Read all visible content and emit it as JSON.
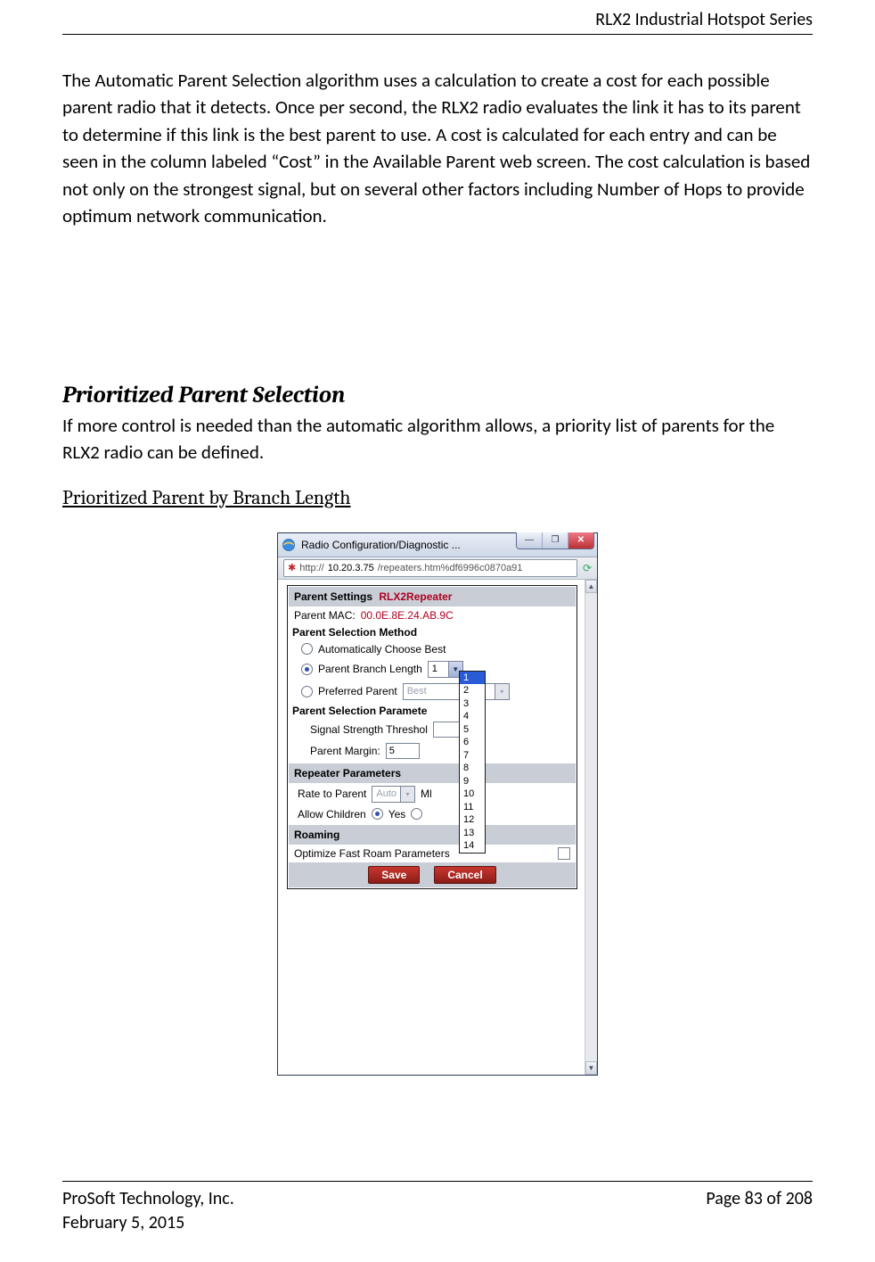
{
  "header": {
    "series": "RLX2 Industrial Hotspot Series"
  },
  "para1": "The Automatic Parent Selection algorithm uses a calculation to create a cost for each possible parent radio that it detects.  Once per second, the RLX2 radio evaluates the link it has to its parent to determine if this link is the best parent to use.  A cost is calculated for each entry and can be seen in the column labeled “Cost” in the Available Parent web screen.  The cost calculation is based not only on the strongest signal, but on several other factors including Number of Hops to provide optimum network communication.",
  "heading2": "Prioritized Parent Selection",
  "para2": "If more control is needed than the automatic algorithm allows, a priority list of parents for the RLX2 radio can be defined.",
  "heading3": "Prioritized Parent by Branch Length",
  "dialog": {
    "title": "Radio Configuration/Diagnostic ...",
    "url_prefix": "http://",
    "url_host": "10.20.3.75",
    "url_path": "/repeaters.htm%df6996c0870a91",
    "parent_settings_label": "Parent Settings",
    "parent_settings_name": "RLX2Repeater",
    "parent_mac_label": "Parent MAC:",
    "parent_mac_value": "00.0E.8E.24.AB.9C",
    "psm_label": "Parent Selection Method",
    "opt_auto": "Automatically Choose Best",
    "opt_branch": "Parent Branch Length",
    "branch_value": "1",
    "opt_preferred": "Preferred Parent",
    "preferred_value": "Best",
    "psp_label": "Parent Selection Paramete",
    "sst_label": "Signal Strength Threshol",
    "pm_label": "Parent Margin:",
    "pm_value": "5",
    "rp_label": "Repeater Parameters",
    "rate_label": "Rate to Parent",
    "rate_value": "Auto",
    "rate_unit": "Ml",
    "allow_label": "Allow Children",
    "yes_label": "Yes",
    "roaming_label": "Roaming",
    "ofrp_label": "Optimize Fast Roam Parameters",
    "save": "Save",
    "cancel": "Cancel",
    "dd_options": [
      "1",
      "2",
      "3",
      "4",
      "5",
      "6",
      "7",
      "8",
      "9",
      "10",
      "11",
      "12",
      "13",
      "14"
    ]
  },
  "footer": {
    "company": "ProSoft Technology, Inc.",
    "date": "February 5, 2015",
    "page": "Page 83 of 208"
  }
}
